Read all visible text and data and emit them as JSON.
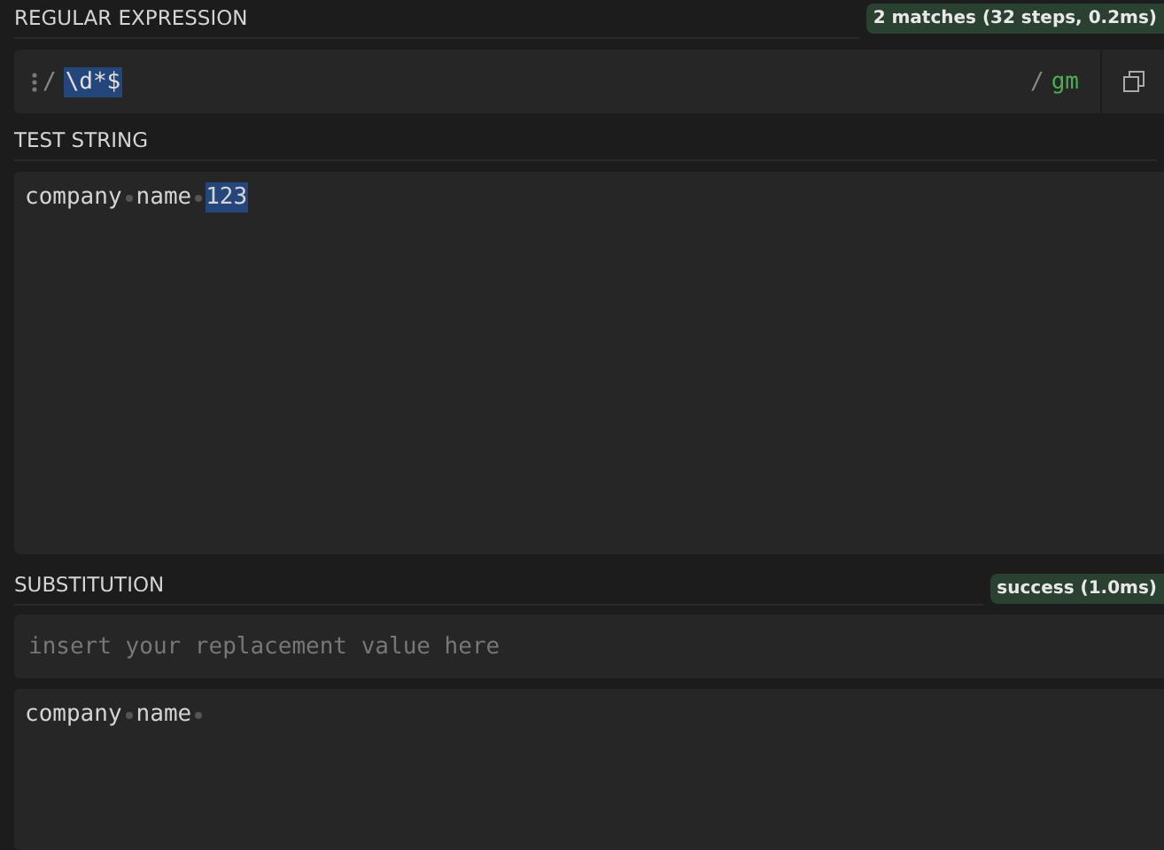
{
  "regex": {
    "heading": "REGULAR EXPRESSION",
    "status": "2 matches (32 steps, 0.2ms)",
    "delimiter": "/",
    "pattern": "\\d*$",
    "pattern_highlighted": true,
    "closing_delimiter": "/",
    "flags": "gm"
  },
  "test_string": {
    "heading": "TEST STRING",
    "tokens": [
      {
        "text": "company",
        "highlighted": false,
        "trailing_space": true
      },
      {
        "text": "name",
        "highlighted": false,
        "trailing_space": true
      },
      {
        "text": "123",
        "highlighted": true,
        "trailing_space": false
      }
    ]
  },
  "substitution": {
    "heading": "SUBSTITUTION",
    "status": "success (1.0ms)",
    "placeholder": "insert your replacement value here",
    "result_tokens": [
      {
        "text": "company",
        "highlighted": false,
        "trailing_space": true
      },
      {
        "text": "name",
        "highlighted": false,
        "trailing_space": true
      }
    ]
  }
}
